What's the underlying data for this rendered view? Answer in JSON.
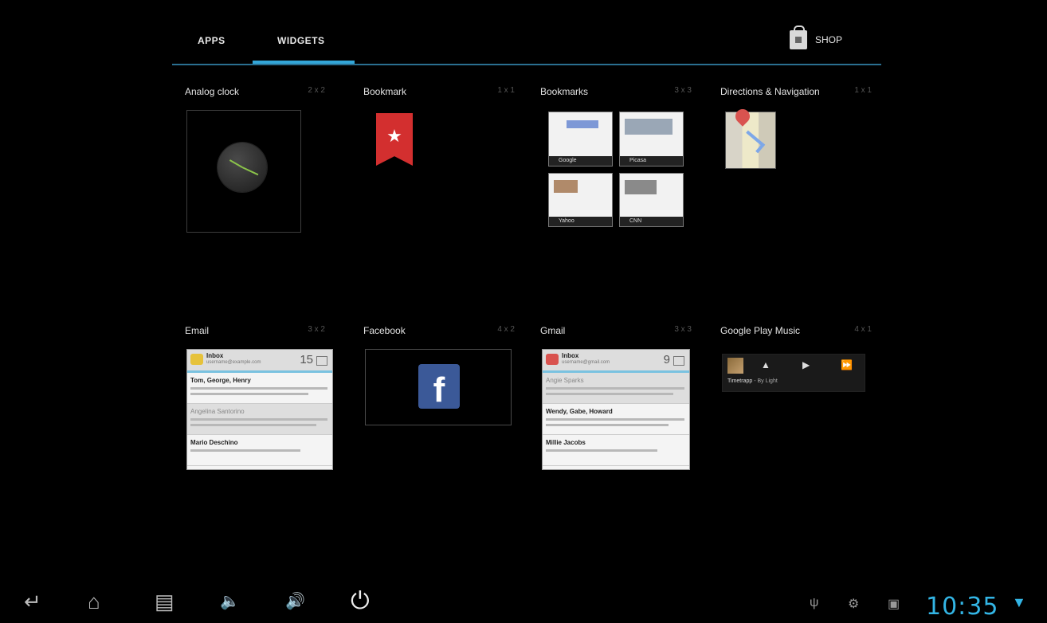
{
  "tabs": {
    "apps": "APPS",
    "widgets": "WIDGETS"
  },
  "shop": {
    "label": "SHOP"
  },
  "widgets": [
    {
      "title": "Analog clock",
      "size": "2 x 2"
    },
    {
      "title": "Bookmark",
      "size": "1 x 1"
    },
    {
      "title": "Bookmarks",
      "size": "3 x 3"
    },
    {
      "title": "Directions & Navigation",
      "size": "1 x 1"
    },
    {
      "title": "Email",
      "size": "3 x 2"
    },
    {
      "title": "Facebook",
      "size": "4 x 2"
    },
    {
      "title": "Gmail",
      "size": "3 x 3"
    },
    {
      "title": "Google Play Music",
      "size": "4 x 1"
    }
  ],
  "bookmarks_tiles": [
    "Google",
    "Picasa",
    "Yahoo",
    "CNN"
  ],
  "email_widget": {
    "inbox": "Inbox",
    "account": "username@example.com",
    "count": "15",
    "rows": [
      {
        "from": "Tom, George, Henry"
      },
      {
        "from": "Angelina Santorino"
      },
      {
        "from": "Mario Deschino"
      }
    ]
  },
  "gmail_widget": {
    "inbox": "Inbox",
    "account": "username@gmail.com",
    "count": "9",
    "rows": [
      {
        "from": "Angie Sparks"
      },
      {
        "from": "Wendy, Gabe, Howard"
      },
      {
        "from": "Millie Jacobs"
      }
    ]
  },
  "facebook_widget": {
    "logo": "f"
  },
  "music_widget": {
    "track": "Timetrapp",
    "artist": "By Light"
  },
  "status": {
    "time": "10:35"
  }
}
